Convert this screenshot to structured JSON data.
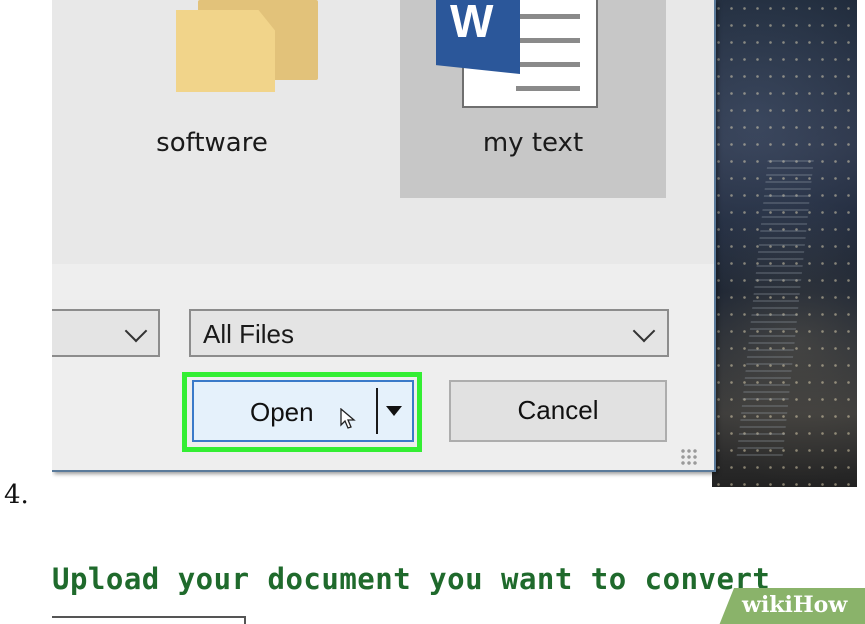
{
  "step": {
    "number": "4."
  },
  "dialog": {
    "files": [
      {
        "name": "software",
        "icon": "folder-icon"
      },
      {
        "name": "my text",
        "icon": "word-document-icon",
        "selected": true
      }
    ],
    "word_badge_letter": "W",
    "file_type_filter": "All Files",
    "buttons": {
      "open_label": "Open",
      "cancel_label": "Cancel"
    },
    "highlight_color": "#33ee33"
  },
  "side_text": {
    "lines": [
      "f",
      "P",
      "y",
      "V",
      "t",
      "f"
    ]
  },
  "page": {
    "heading": "Upload your document you want to convert"
  },
  "watermark": {
    "text": "wikiHow",
    "color": "#8ab36a"
  }
}
